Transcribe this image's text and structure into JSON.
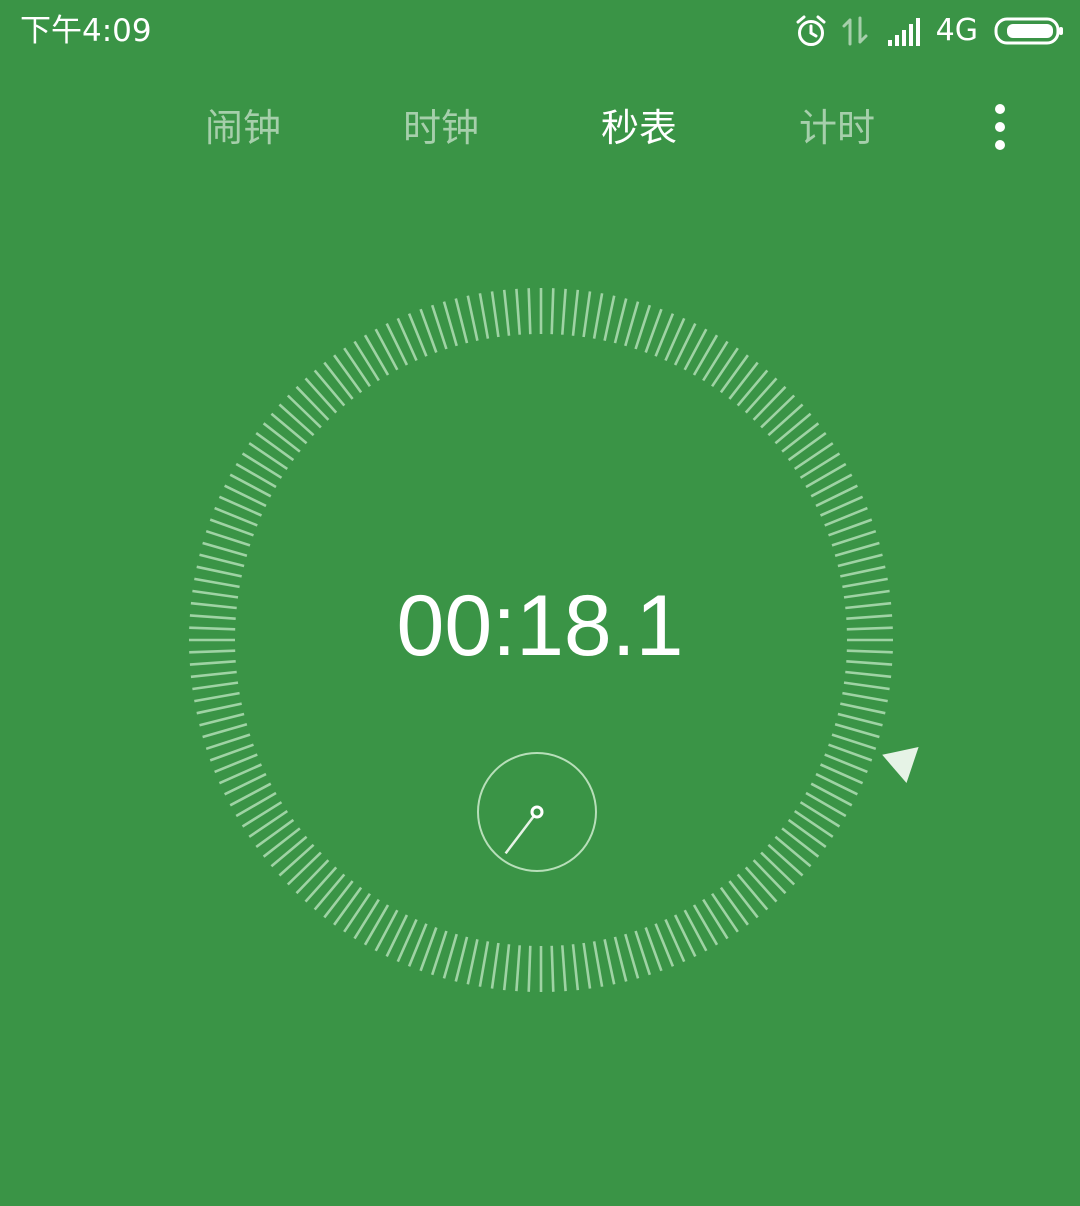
{
  "status_bar": {
    "time": "下午4:09",
    "network_type": "4G",
    "icons": [
      "alarm-icon",
      "data-transfer-icon",
      "signal-icon",
      "battery-icon"
    ]
  },
  "tabs": [
    {
      "label": "闹钟",
      "active": false
    },
    {
      "label": "时钟",
      "active": false
    },
    {
      "label": "秒表",
      "active": true
    },
    {
      "label": "计时",
      "active": false
    }
  ],
  "menu": {
    "icon": "more-vert-icon"
  },
  "stopwatch": {
    "elapsed": "00:18.1",
    "seconds": 18.1
  },
  "colors": {
    "background": "#3a9446",
    "text": "#ffffff",
    "tick": "#9fd3a4",
    "inactive_tab": "rgba(255,255,255,0.55)"
  }
}
